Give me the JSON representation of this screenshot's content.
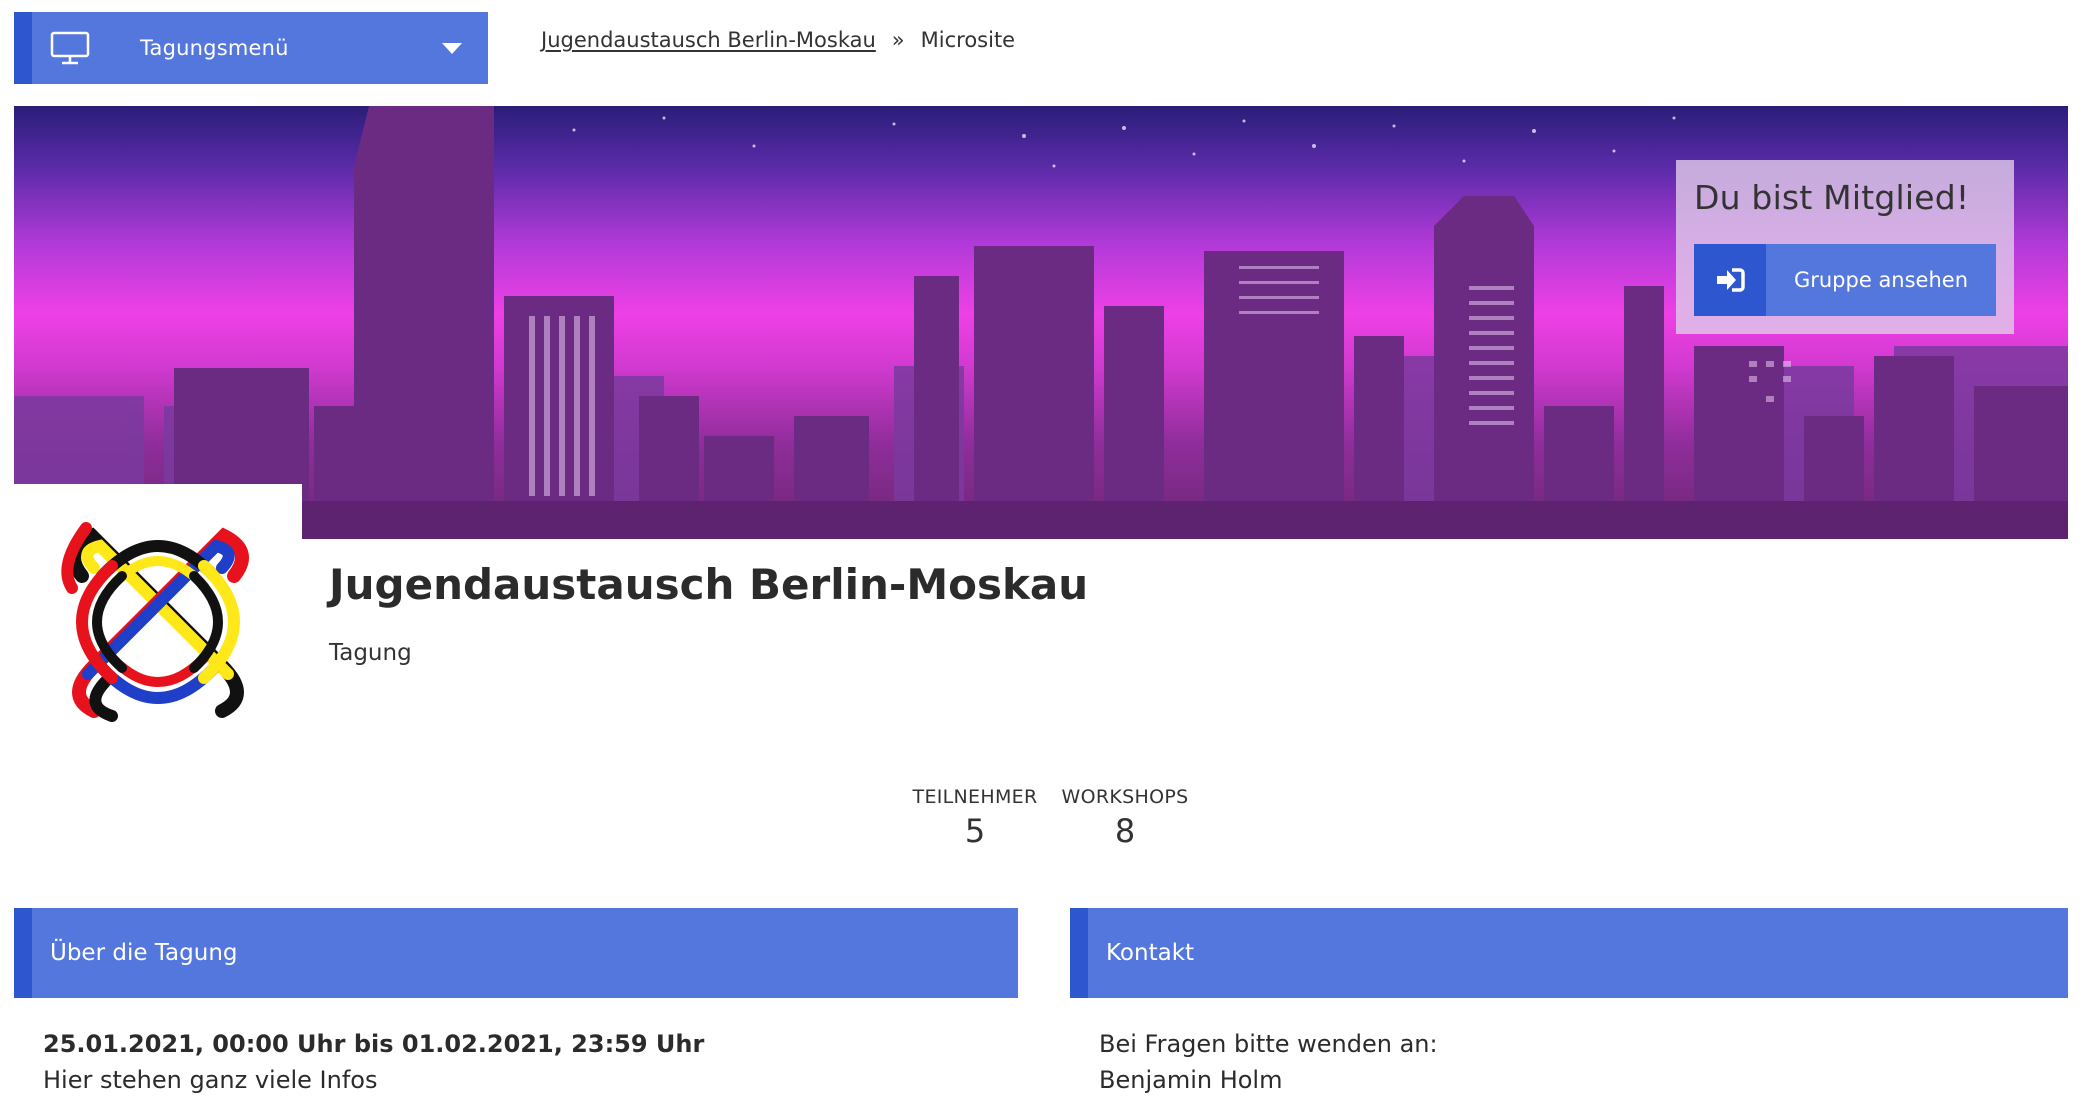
{
  "menu": {
    "label": "Tagungsmenü"
  },
  "breadcrumb": {
    "parent": "Jugendaustausch Berlin-Moskau",
    "separator": "»",
    "current": "Microsite"
  },
  "member_box": {
    "title": "Du bist Mitglied!",
    "button_label": "Gruppe ansehen"
  },
  "group": {
    "title": "Jugendaustausch Berlin-Moskau",
    "type": "Tagung"
  },
  "stats": [
    {
      "label": "TEILNEHMER",
      "value": "5"
    },
    {
      "label": "WORKSHOPS",
      "value": "8"
    }
  ],
  "about": {
    "header": "Über die Tagung",
    "date_range": "25.01.2021, 00:00 Uhr bis 01.02.2021, 23:59 Uhr",
    "text": "Hier stehen ganz viele Infos"
  },
  "contact": {
    "header": "Kontakt",
    "line1": "Bei Fragen bitte wenden an:",
    "line2": "Benjamin Holm"
  },
  "colors": {
    "primary": "#5477de",
    "primary_dark": "#2e57cf"
  },
  "icons": {
    "menu": "monitor-icon",
    "dropdown": "chevron-down-icon",
    "login": "sign-in-icon"
  }
}
